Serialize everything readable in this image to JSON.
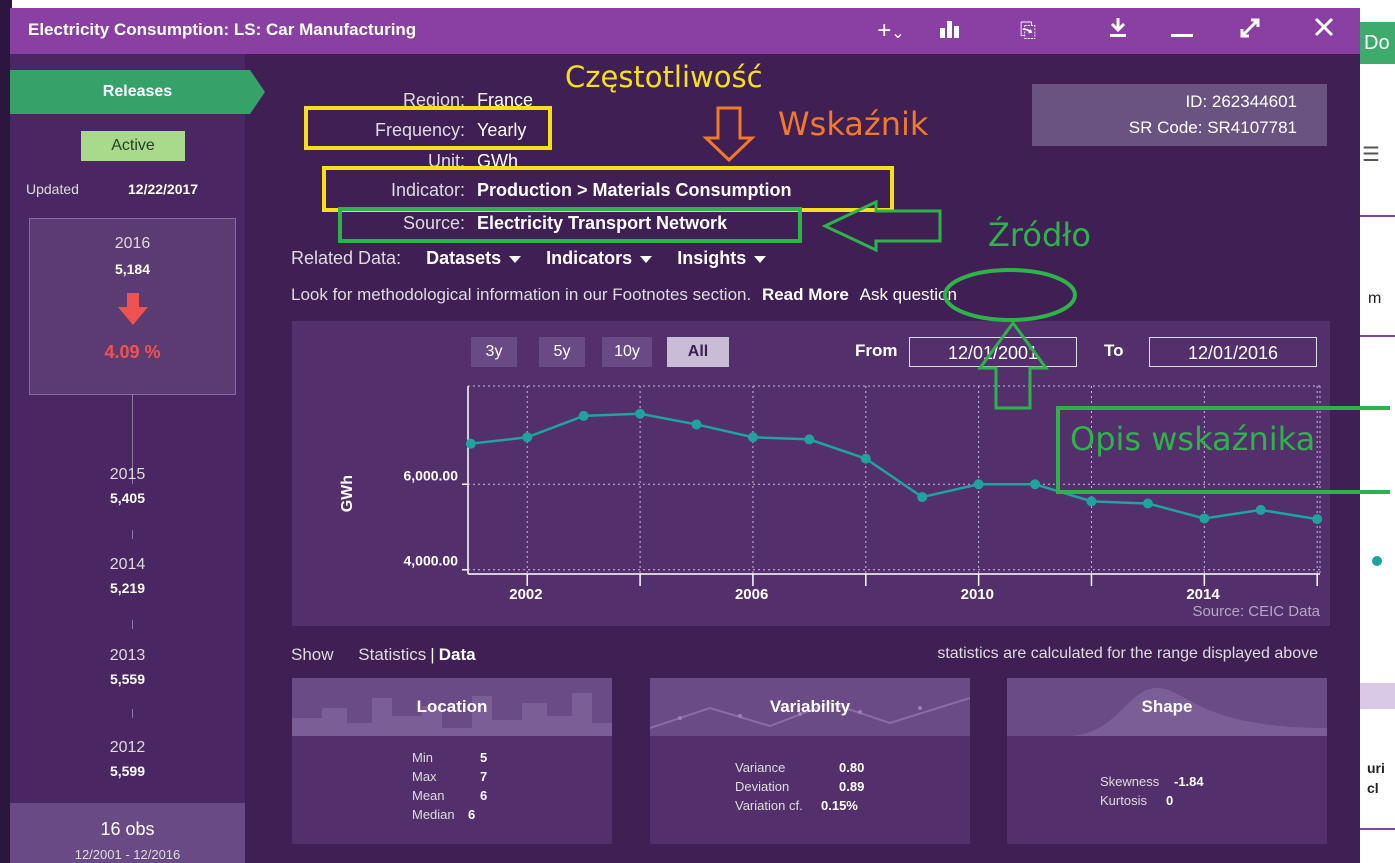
{
  "window": {
    "title": "Electricity Consumption: LS: Car Manufacturing",
    "toolbar_icons": [
      "plus-dropdown-icon",
      "bar-chart-icon",
      "copy-icon",
      "download-icon",
      "minimize-icon",
      "expand-icon",
      "close-icon"
    ]
  },
  "sidebar": {
    "releases_tab": "Releases",
    "status_badge": "Active",
    "updated_label": "Updated",
    "updated_date": "12/22/2017",
    "current": {
      "year": "2016",
      "value": "5,184",
      "change": "4.09 %"
    },
    "releases": [
      {
        "year": "2015",
        "value": "5,405"
      },
      {
        "year": "2014",
        "value": "5,219"
      },
      {
        "year": "2013",
        "value": "5,559"
      },
      {
        "year": "2012",
        "value": "5,599"
      }
    ],
    "obs_count": "16 obs",
    "obs_range": "12/2001 - 12/2016"
  },
  "meta": {
    "region_label": "Region:",
    "region": "France",
    "frequency_label": "Frequency:",
    "frequency": "Yearly",
    "unit_label": "Unit:",
    "unit": "GWh",
    "indicator_label": "Indicator:",
    "indicator": "Production > Materials Consumption",
    "source_label": "Source:",
    "source": "Electricity Transport Network",
    "id": "ID: 262344601",
    "sr_code": "SR Code: SR4107781"
  },
  "related": {
    "label": "Related Data:",
    "datasets": "Datasets",
    "indicators": "Indicators",
    "insights": "Insights"
  },
  "footnote": {
    "text": "Look for methodological information in our Footnotes section.",
    "read_more": "Read More",
    "ask": "Ask question"
  },
  "chart_controls": {
    "ranges": [
      "3y",
      "5y",
      "10y",
      "All"
    ],
    "selected": "All",
    "from_label": "From",
    "from": "12/01/2001",
    "to_label": "To",
    "to": "12/01/2016",
    "source": "Source: CEIC Data"
  },
  "chart_data": {
    "type": "line",
    "ylabel": "GWh",
    "x": [
      2001,
      2002,
      2003,
      2004,
      2005,
      2006,
      2007,
      2008,
      2009,
      2010,
      2011,
      2012,
      2013,
      2014,
      2015,
      2016
    ],
    "values": [
      6950,
      7100,
      7600,
      7650,
      7400,
      7100,
      7050,
      6600,
      5700,
      6000,
      6000,
      5600,
      5550,
      5200,
      5400,
      5184
    ],
    "xticks": [
      "2002",
      "2006",
      "2010",
      "2014"
    ],
    "yticks": [
      "4,000.00",
      "6,000.00"
    ],
    "ylim": [
      3900,
      8300
    ],
    "series_color": "#1fa39d",
    "grid": true
  },
  "stats": {
    "show_label": "Show",
    "statistics_tab": "Statistics",
    "data_tab": "Data",
    "note": "statistics are calculated for the range displayed above",
    "location": {
      "title": "Location",
      "rows": [
        [
          "Min",
          "5"
        ],
        [
          "Max",
          "7"
        ],
        [
          "Mean",
          "6"
        ],
        [
          "Median",
          "6"
        ]
      ]
    },
    "variability": {
      "title": "Variability",
      "rows": [
        [
          "Variance",
          "0.80"
        ],
        [
          "Deviation",
          "0.89"
        ],
        [
          "Variation cf.",
          "0.15%"
        ]
      ]
    },
    "shape": {
      "title": "Shape",
      "rows": [
        [
          "Skewness",
          "-1.84"
        ],
        [
          "Kurtosis",
          "0"
        ]
      ]
    }
  },
  "annotations": {
    "czestotliwosc": "Częstotliwość",
    "wskaznik": "Wskaźnik",
    "zrodlo": "Źródło",
    "opis": "Opis wskaźnika"
  },
  "background": {
    "tab_fragment": "Do",
    "frag_m": "m",
    "frag_ur": "uri",
    "frag_cl": "cl"
  },
  "colors": {
    "title_bar": "#8a3fa3",
    "panel": "#3f1f54",
    "accent_green": "#35a26a",
    "highlight_yellow": "#f5e11a",
    "annot_green": "#2db34a",
    "annot_orange": "#f07a2a",
    "down_red": "#ef5350"
  }
}
